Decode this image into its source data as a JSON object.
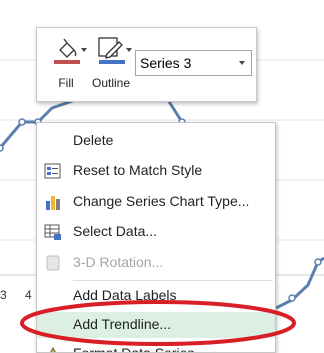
{
  "axis_labels": [
    "3",
    "4"
  ],
  "colors": {
    "series_line": "#5b7faf",
    "fill_swatch": "#c0504d",
    "outline_swatch": "#4472c4",
    "highlight": "#dcefe3",
    "annotation": "#d81f26"
  },
  "mini_toolbar": {
    "fill_label": "Fill",
    "outline_label": "Outline",
    "series_value": "Series 3"
  },
  "menu": {
    "items": [
      {
        "label": "Delete",
        "icon": null
      },
      {
        "label": "Reset to Match Style",
        "icon": "reset-style-icon"
      },
      {
        "label": "Change Series Chart Type...",
        "icon": "bar-chart-icon"
      },
      {
        "label": "Select Data...",
        "icon": "select-data-icon"
      },
      {
        "label": "3-D Rotation...",
        "icon": "rotation-icon"
      },
      {
        "label": "Add Data Labels",
        "icon": null
      },
      {
        "label": "Add Trendline...",
        "icon": null
      },
      {
        "label": "Format Data Series...",
        "icon": "format-series-icon"
      }
    ]
  }
}
